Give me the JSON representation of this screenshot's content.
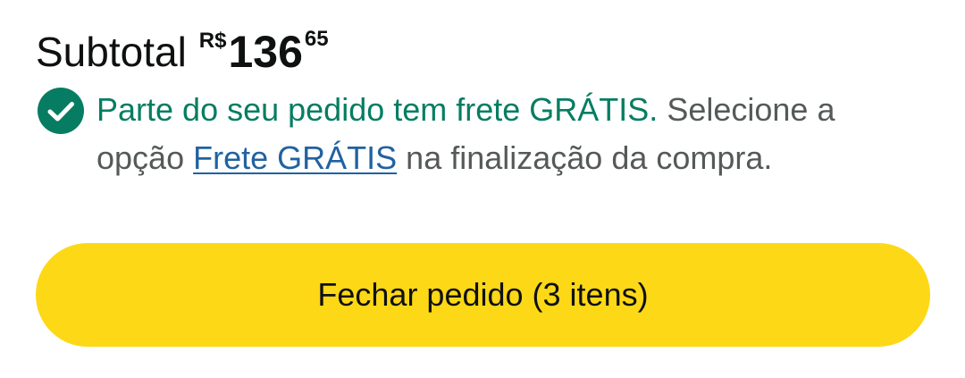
{
  "subtotal": {
    "label": "Subtotal",
    "currency_symbol": "R$",
    "price_whole": "136",
    "price_fraction": "65"
  },
  "shipping": {
    "icon": "check-circle-icon",
    "free_note": "Parte do seu pedido tem frete GRÁTIS.",
    "instruction_before": "Selecione a opção",
    "link_text": "Frete GRÁTIS",
    "instruction_after": "na finalização da compra."
  },
  "checkout": {
    "button_label": "Fechar pedido (3 itens)"
  },
  "colors": {
    "success_green": "#067d62",
    "link_blue": "#2162a1",
    "button_yellow": "#fdd816",
    "secondary_text": "#565959"
  }
}
